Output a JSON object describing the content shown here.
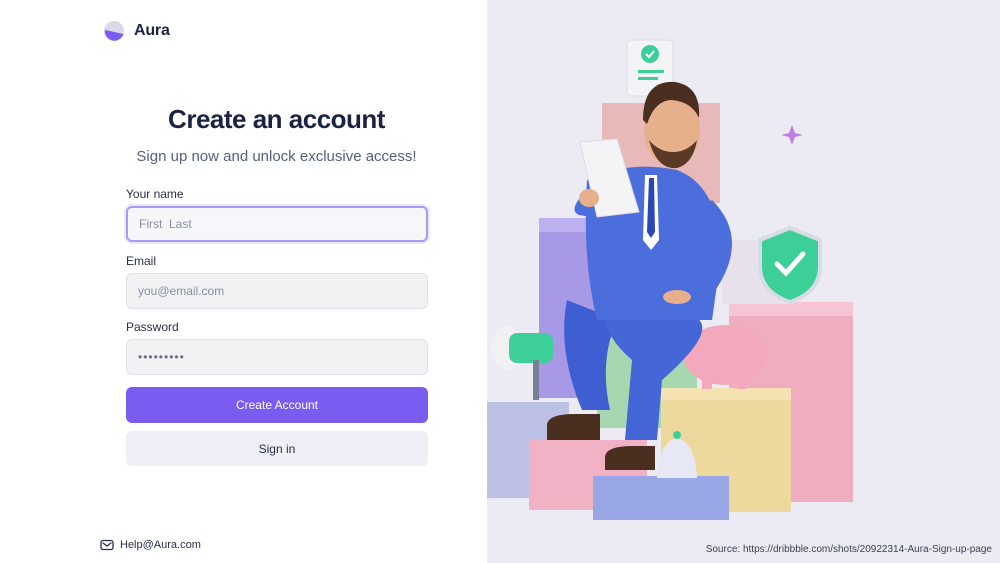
{
  "brand": {
    "name": "Aura",
    "logo_icon": "aura-logo-icon"
  },
  "form": {
    "title": "Create an account",
    "subtitle": "Sign up now and unlock exclusive access!",
    "name_label": "Your name",
    "name_placeholder": "First  Last",
    "email_label": "Email",
    "email_placeholder": "you@email.com",
    "password_label": "Password",
    "password_placeholder": "•••••••••",
    "create_button": "Create Account",
    "signin_button": "Sign in"
  },
  "footer": {
    "help_email": "Help@Aura.com",
    "help_icon": "mail-icon"
  },
  "source_note": "Source: https://dribbble.com/shots/20922314-Aura-Sign-up-page",
  "colors": {
    "accent": "#7a5cf0",
    "panel_bg": "#ecebf3",
    "title": "#1b2345"
  }
}
